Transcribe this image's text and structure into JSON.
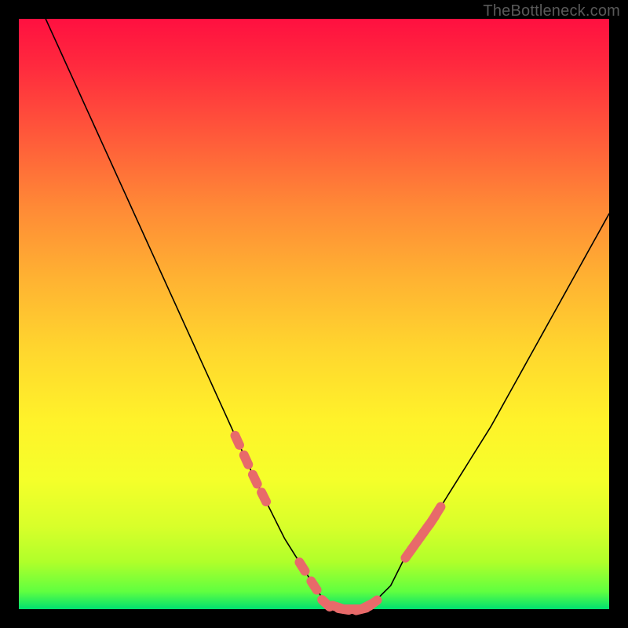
{
  "watermark": "TheBottleneck.com",
  "colors": {
    "background": "#000000",
    "gradient_top": "#ff1040",
    "gradient_bottom": "#00e070",
    "curve": "#000000",
    "marker": "#e86a6a"
  },
  "chart_data": {
    "type": "line",
    "title": "",
    "xlabel": "",
    "ylabel": "",
    "xlim": [
      0,
      100
    ],
    "ylim": [
      0,
      100
    ],
    "x": [
      0,
      5,
      10,
      15,
      20,
      25,
      30,
      35,
      40,
      45,
      50,
      52,
      55,
      58,
      60,
      63,
      65,
      70,
      75,
      80,
      85,
      90,
      95,
      100
    ],
    "values": [
      110,
      99,
      88,
      77,
      66,
      55,
      44,
      33,
      22,
      12,
      4,
      1,
      0,
      0,
      1,
      4,
      8,
      15,
      23,
      31,
      40,
      49,
      58,
      67
    ],
    "marker_points_x": [
      37,
      38.5,
      40,
      41.5,
      48,
      50,
      52,
      54,
      55,
      56,
      57,
      58,
      59,
      60,
      66,
      67,
      68,
      69,
      70,
      71
    ],
    "curve_stroke_width": 1.6,
    "marker_radius": 6
  }
}
